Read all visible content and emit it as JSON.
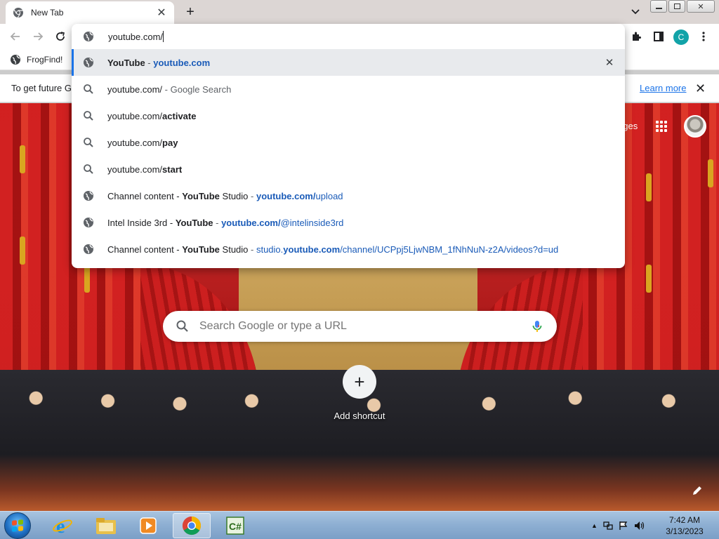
{
  "tab": {
    "title": "New Tab"
  },
  "bookmarks": [
    {
      "label": "FrogFind!"
    }
  ],
  "infobar": {
    "text": "To get future G",
    "link": "Learn more"
  },
  "profile": {
    "initial": "C"
  },
  "omnibox": {
    "value": "youtube.com/",
    "suggestions": [
      {
        "icon": "globe-icon",
        "parts": [
          {
            "t": "YouTube",
            "c": "b"
          },
          {
            "t": " - ",
            "c": "sep"
          },
          {
            "t": "youtube.com",
            "c": "url b"
          }
        ],
        "selected": true
      },
      {
        "icon": "search-icon",
        "parts": [
          {
            "t": "youtube.com/",
            "c": ""
          },
          {
            "t": " - Google Search",
            "c": "muted"
          }
        ]
      },
      {
        "icon": "search-icon",
        "parts": [
          {
            "t": "youtube.com/",
            "c": ""
          },
          {
            "t": "activate",
            "c": "b"
          }
        ]
      },
      {
        "icon": "search-icon",
        "parts": [
          {
            "t": "youtube.com/",
            "c": ""
          },
          {
            "t": "pay",
            "c": "b"
          }
        ]
      },
      {
        "icon": "search-icon",
        "parts": [
          {
            "t": "youtube.com/",
            "c": ""
          },
          {
            "t": "start",
            "c": "b"
          }
        ]
      },
      {
        "icon": "globe-icon",
        "parts": [
          {
            "t": "Channel content - ",
            "c": ""
          },
          {
            "t": "YouTube",
            "c": "b"
          },
          {
            "t": " Studio",
            "c": ""
          },
          {
            "t": " - ",
            "c": "sep"
          },
          {
            "t": "youtube.com/",
            "c": "url b"
          },
          {
            "t": "upload",
            "c": "url"
          }
        ]
      },
      {
        "icon": "globe-icon",
        "parts": [
          {
            "t": "Intel Inside 3rd - ",
            "c": ""
          },
          {
            "t": "YouTube",
            "c": "b"
          },
          {
            "t": " - ",
            "c": "sep"
          },
          {
            "t": "youtube.com/",
            "c": "url b"
          },
          {
            "t": "@intelinside3rd",
            "c": "url"
          }
        ]
      },
      {
        "icon": "globe-icon",
        "parts": [
          {
            "t": "Channel content - ",
            "c": ""
          },
          {
            "t": "YouTube",
            "c": "b"
          },
          {
            "t": " Studio",
            "c": ""
          },
          {
            "t": " - ",
            "c": "sep"
          },
          {
            "t": "studio.",
            "c": "url"
          },
          {
            "t": "youtube.com",
            "c": "url b"
          },
          {
            "t": "/channel/UCPpj5LjwNBM_1fNhNuN-z2A/videos?d=ud",
            "c": "url"
          }
        ]
      }
    ]
  },
  "ntp": {
    "images_link": "ages",
    "search_placeholder": "Search Google or type a URL",
    "add_shortcut": "Add shortcut"
  },
  "taskbar": {
    "apps": [
      "internet-explorer-icon",
      "file-explorer-icon",
      "media-player-icon",
      "chrome-icon",
      "csharp-icon"
    ],
    "time": "7:42 AM",
    "date": "3/13/2023"
  },
  "colors": {
    "accent": "#1a73e8",
    "url": "#1a5bb8",
    "avatar": "#12a3a8"
  }
}
